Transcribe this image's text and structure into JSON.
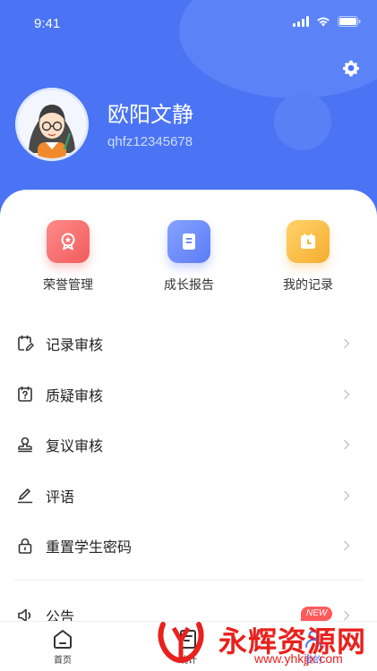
{
  "status_bar": {
    "time": "9:41"
  },
  "profile": {
    "name": "欧阳文静",
    "id": "qhfz12345678"
  },
  "quick_actions": [
    {
      "label": "荣誉管理",
      "icon": "award-icon",
      "color": "#f15c5c"
    },
    {
      "label": "成长报告",
      "icon": "report-icon",
      "color": "#5c7cf5"
    },
    {
      "label": "我的记录",
      "icon": "calendar-record-icon",
      "color": "#f5ad2f"
    }
  ],
  "menu": [
    {
      "label": "记录审核",
      "icon": "calendar-edit-icon"
    },
    {
      "label": "质疑审核",
      "icon": "calendar-question-icon"
    },
    {
      "label": "复议审核",
      "icon": "stamp-icon"
    },
    {
      "label": "评语",
      "icon": "pen-icon"
    },
    {
      "label": "重置学生密码",
      "icon": "lock-icon"
    }
  ],
  "notice": {
    "label": "公告",
    "icon": "speaker-icon",
    "badge": "NEW"
  },
  "tabbar": [
    {
      "label": "首页",
      "icon": "home-icon"
    },
    {
      "label": "统计",
      "icon": "stats-icon"
    },
    {
      "label": "我的",
      "icon": "profile-icon",
      "active": true
    }
  ],
  "watermark": {
    "text": "永辉资源网",
    "url": "www.yhkjjx.com"
  },
  "colors": {
    "primary": "#4a74f4",
    "red": "#f15c5c",
    "yellow": "#f5ad2f",
    "watermark": "#e8211d"
  }
}
